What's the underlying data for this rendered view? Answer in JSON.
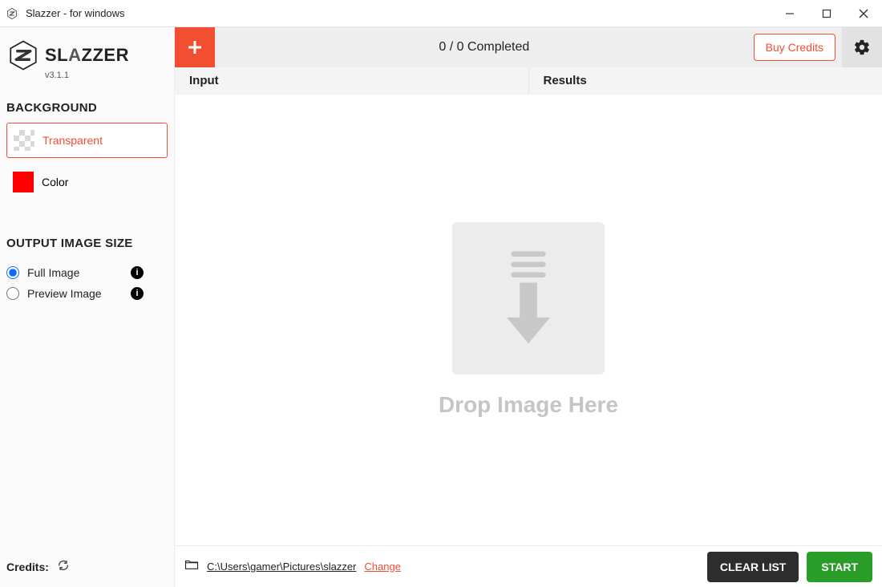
{
  "window": {
    "title": "Slazzer - for windows"
  },
  "brand": {
    "name": "SLAZZER",
    "version": "v3.1.1"
  },
  "sidebar": {
    "background": {
      "heading": "BACKGROUND",
      "transparent_label": "Transparent",
      "color_label": "Color",
      "color_value": "#ff0000"
    },
    "output_size": {
      "heading": "OUTPUT IMAGE SIZE",
      "full_label": "Full Image",
      "preview_label": "Preview Image",
      "selected": "full"
    },
    "credits_label": "Credits:"
  },
  "topbar": {
    "progress": "0 / 0 Completed",
    "buy_label": "Buy Credits"
  },
  "columns": {
    "input": "Input",
    "results": "Results"
  },
  "drop": {
    "text": "Drop Image Here"
  },
  "footer": {
    "path": "C:\\Users\\gamer\\Pictures\\slazzer",
    "change": "Change",
    "clear": "CLEAR LIST",
    "start": "START"
  }
}
